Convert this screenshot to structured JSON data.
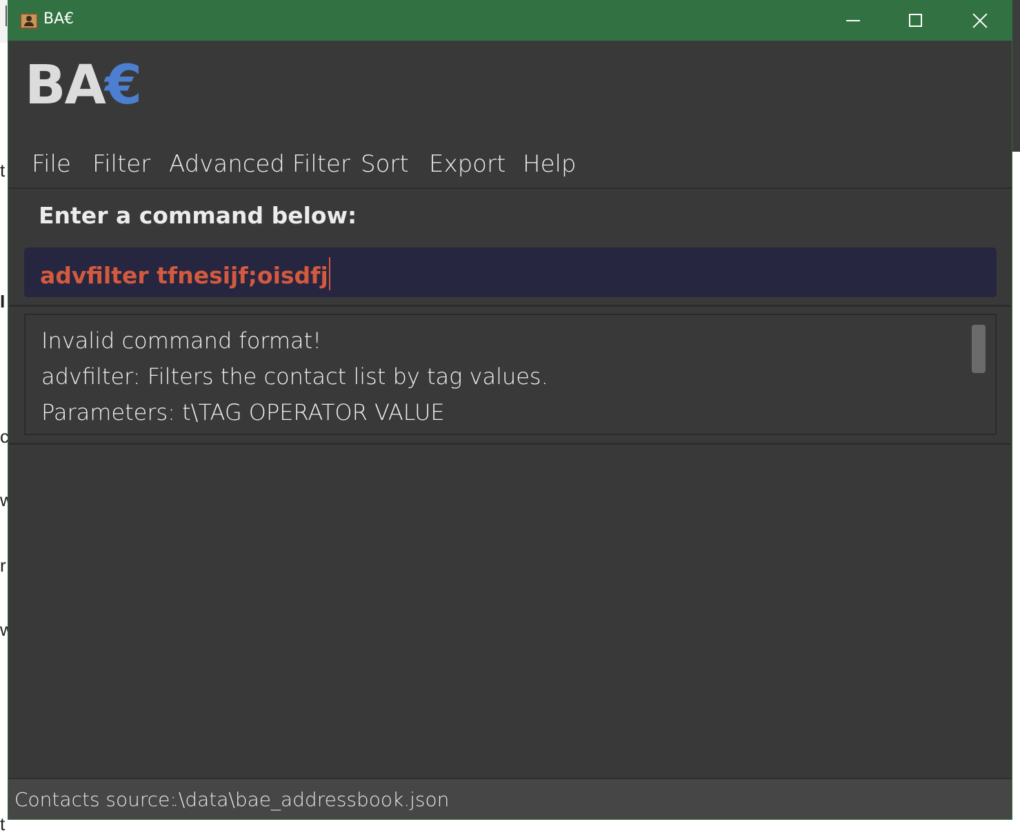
{
  "window": {
    "title": "BA€"
  },
  "logo": {
    "main": "BA",
    "accent": "€",
    "accent_color": "#4c7fcf"
  },
  "menu": {
    "items": [
      "File",
      "Filter",
      "Advanced Filter",
      "Sort",
      "Export",
      "Help"
    ]
  },
  "command": {
    "label": "Enter a command below:",
    "value": "advfilter tfnesijf;oisdfj",
    "text_color": "#d35a3e"
  },
  "result": {
    "lines": [
      "Invalid command format!",
      "advfilter: Filters the contact list by tag values.",
      "Parameters: t\\TAG OPERATOR VALUE"
    ]
  },
  "status": {
    "label": "Contacts source:",
    "path": ".\\data\\bae_addressbook.json"
  },
  "colors": {
    "titlebar": "#327242",
    "background": "#393939",
    "input_background": "#262640"
  }
}
